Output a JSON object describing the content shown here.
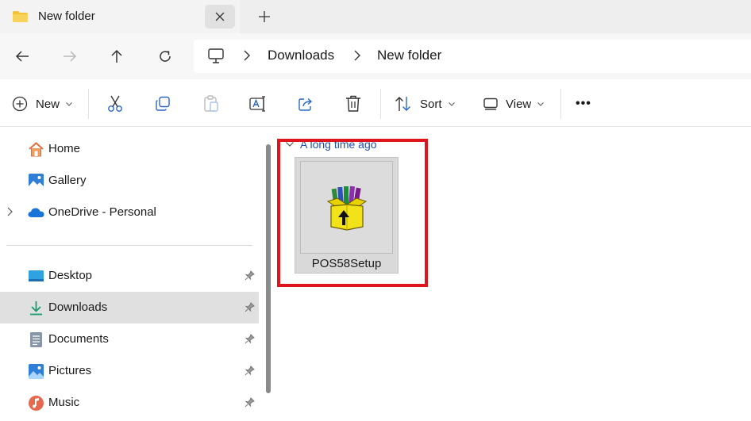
{
  "tab": {
    "title": "New folder",
    "close_icon": "close-icon",
    "new_tab_icon": "plus-icon"
  },
  "nav": {
    "back": "arrow-left-icon",
    "forward": "arrow-right-icon",
    "up": "arrow-up-icon",
    "refresh": "refresh-icon"
  },
  "breadcrumb": {
    "root_icon": "computer-icon",
    "items": [
      "Downloads",
      "New folder"
    ]
  },
  "commands": {
    "new_label": "New",
    "sort_label": "Sort",
    "view_label": "View",
    "more_label": "•••"
  },
  "sidebar": {
    "items": [
      {
        "label": "Home",
        "icon": "home-icon"
      },
      {
        "label": "Gallery",
        "icon": "gallery-icon"
      },
      {
        "label": "OneDrive - Personal",
        "icon": "cloud-icon"
      },
      {
        "label": "Desktop",
        "icon": "desktop-icon"
      },
      {
        "label": "Downloads",
        "icon": "download-icon"
      },
      {
        "label": "Documents",
        "icon": "document-icon"
      },
      {
        "label": "Pictures",
        "icon": "pictures-icon"
      },
      {
        "label": "Music",
        "icon": "music-icon"
      }
    ],
    "selected": "Downloads"
  },
  "content": {
    "group_title": "A long time ago",
    "files": [
      {
        "name": "POS58Setup",
        "icon": "installer-icon"
      }
    ]
  },
  "colors": {
    "accent": "#1e4fb3",
    "highlight": "#e0141b",
    "selected_bg": "#e0e0e0"
  }
}
